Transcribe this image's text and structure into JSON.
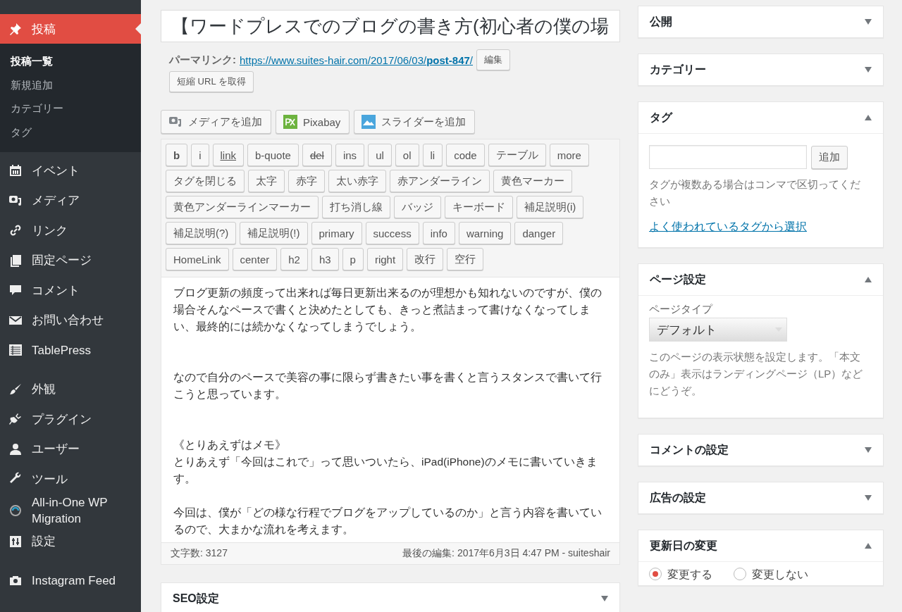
{
  "sidebar": {
    "current": {
      "label": "投稿",
      "submenu": [
        {
          "label": "投稿一覧",
          "selected": true
        },
        {
          "label": "新規追加",
          "selected": false
        },
        {
          "label": "カテゴリー",
          "selected": false
        },
        {
          "label": "タグ",
          "selected": false
        }
      ]
    },
    "menu_groups": [
      [
        {
          "label": "イベント"
        },
        {
          "label": "メディア"
        },
        {
          "label": "リンク"
        },
        {
          "label": "固定ページ"
        },
        {
          "label": "コメント"
        },
        {
          "label": "お問い合わせ"
        },
        {
          "label": "TablePress"
        }
      ],
      [
        {
          "label": "外観"
        },
        {
          "label": "プラグイン"
        },
        {
          "label": "ユーザー"
        },
        {
          "label": "ツール"
        },
        {
          "label": "All-in-One WP Migration"
        },
        {
          "label": "設定"
        }
      ],
      [
        {
          "label": "Instagram Feed"
        }
      ]
    ]
  },
  "post": {
    "title": "【ワードプレスでのブログの書き方(初心者の僕の場",
    "permalink": {
      "label": "パーマリンク:",
      "url_start": "https://www.suites-hair.com/2017/06/03/",
      "url_slug": "post-847",
      "url_end": "/",
      "edit_button": "編集",
      "shortlink_button": "短縮 URL を取得"
    },
    "media_buttons": [
      {
        "label": "メディアを追加"
      },
      {
        "label": "Pixabay"
      },
      {
        "label": "スライダーを追加"
      }
    ],
    "quicktags": [
      [
        {
          "label": "b",
          "kind": "bold"
        },
        {
          "label": "i",
          "kind": "plain"
        },
        {
          "label": "link",
          "kind": "underline"
        },
        {
          "label": "b-quote",
          "kind": "plain"
        },
        {
          "label": "del",
          "kind": "strike"
        },
        {
          "label": "ins",
          "kind": "plain"
        },
        {
          "label": "ul",
          "kind": "plain"
        },
        {
          "label": "ol",
          "kind": "plain"
        },
        {
          "label": "li",
          "kind": "plain"
        },
        {
          "label": "code",
          "kind": "plain"
        },
        {
          "label": "テーブル",
          "kind": "plain"
        },
        {
          "label": "more",
          "kind": "plain"
        }
      ],
      [
        {
          "label": "タグを閉じる",
          "kind": "plain"
        },
        {
          "label": "太字",
          "kind": "plain"
        },
        {
          "label": "赤字",
          "kind": "plain"
        },
        {
          "label": "太い赤字",
          "kind": "plain"
        },
        {
          "label": "赤アンダーライン",
          "kind": "plain"
        },
        {
          "label": "黄色マーカー",
          "kind": "plain"
        }
      ],
      [
        {
          "label": "黄色アンダーラインマーカー",
          "kind": "plain"
        },
        {
          "label": "打ち消し線",
          "kind": "plain"
        },
        {
          "label": "バッジ",
          "kind": "plain"
        },
        {
          "label": "キーボード",
          "kind": "plain"
        },
        {
          "label": "補足説明(i)",
          "kind": "plain"
        }
      ],
      [
        {
          "label": "補足説明(?)",
          "kind": "plain"
        },
        {
          "label": "補足説明(!)",
          "kind": "plain"
        },
        {
          "label": "primary",
          "kind": "plain"
        },
        {
          "label": "success",
          "kind": "plain"
        },
        {
          "label": "info",
          "kind": "plain"
        },
        {
          "label": "warning",
          "kind": "plain"
        },
        {
          "label": "danger",
          "kind": "plain"
        }
      ],
      [
        {
          "label": "HomeLink",
          "kind": "plain"
        },
        {
          "label": "center",
          "kind": "plain"
        },
        {
          "label": "h2",
          "kind": "plain"
        },
        {
          "label": "h3",
          "kind": "plain"
        },
        {
          "label": "p",
          "kind": "plain"
        },
        {
          "label": "right",
          "kind": "plain"
        },
        {
          "label": "改行",
          "kind": "plain"
        },
        {
          "label": "空行",
          "kind": "plain"
        }
      ]
    ],
    "content": [
      [
        "ブログ更新の頻度って出来れば毎日更新出来るのが理想かも知れないのですが、僕の場合そんなペースで書くと決めたとしても、きっと煮詰まって書けなくなってしまい、最終的には続かなくなってしまうでしょう。"
      ],
      [
        "なので自分のペースで美容の事に限らず書きたい事を書くと言うスタンスで書いて行こうと思っています。"
      ],
      [
        "《とりあえずはメモ》",
        "とりあえず「今回はこれで」って思いついたら、iPad(iPhone)のメモに書いていきます。"
      ],
      [
        "今回は、僕が「どの様な行程でブログをアップしているのか」と言う内容を書いているので、大まかな流れを考えます。"
      ]
    ],
    "word_count": "文字数: 3127",
    "last_edit": "最後の編集: 2017年6月3日 4:47 PM - suiteshair",
    "seo_box": {
      "title": "SEO設定",
      "expanded": false
    }
  },
  "side_boxes": [
    {
      "title": "公開",
      "expanded": false
    },
    {
      "title": "カテゴリー",
      "expanded": false
    },
    {
      "title": "タグ",
      "expanded": true,
      "kind": "tags",
      "add_button": "追加",
      "help": "タグが複数ある場合はコンマで区切ってください",
      "link": "よく使われているタグから選択"
    },
    {
      "title": "ページ設定",
      "expanded": true,
      "kind": "page_settings",
      "field_label": "ページタイプ",
      "select_value": "デフォルト",
      "help": "このページの表示状態を設定します。「本文のみ」表示はランディングページ（LP）などにどうぞ。"
    },
    {
      "title": "コメントの設定",
      "expanded": false
    },
    {
      "title": "広告の設定",
      "expanded": false
    },
    {
      "title": "更新日の変更",
      "expanded": true,
      "kind": "date_change",
      "options": [
        {
          "label": "変更する",
          "selected": true
        },
        {
          "label": "変更しない",
          "selected": false
        }
      ]
    }
  ]
}
